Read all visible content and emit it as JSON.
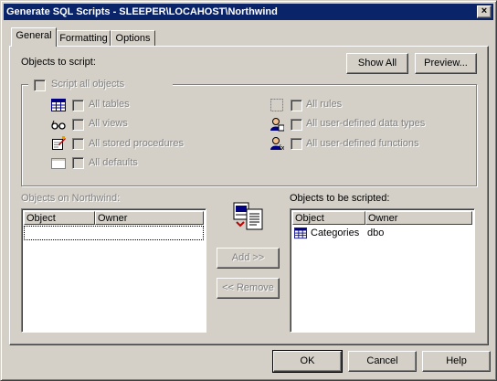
{
  "window": {
    "title": "Generate SQL Scripts - SLEEPER\\LOCAHOST\\Northwind",
    "close_glyph": "×"
  },
  "tabs": [
    {
      "label": "General",
      "active": true
    },
    {
      "label": "Formatting",
      "active": false
    },
    {
      "label": "Options",
      "active": false
    }
  ],
  "objects_to_script": {
    "label": "Objects to script:",
    "show_all": "Show All",
    "preview": "Preview...",
    "script_all": "Script all objects",
    "left_options": [
      {
        "label": "All tables",
        "icon": "table-icon"
      },
      {
        "label": "All views",
        "icon": "glasses-icon"
      },
      {
        "label": "All stored procedures",
        "icon": "stored-procedure-icon"
      },
      {
        "label": "All defaults",
        "icon": "default-icon"
      }
    ],
    "right_options": [
      {
        "label": "All rules",
        "icon": "rule-icon"
      },
      {
        "label": "All user-defined data types",
        "icon": "user-type-icon"
      },
      {
        "label": "All user-defined functions",
        "icon": "user-function-icon"
      }
    ]
  },
  "objects_on_db": {
    "label": "Objects on Northwind:",
    "columns": [
      "Object",
      "Owner"
    ],
    "rows": []
  },
  "objects_scripted": {
    "label": "Objects to be scripted:",
    "columns": [
      "Object",
      "Owner"
    ],
    "rows": [
      {
        "object": "Categories",
        "owner": "dbo"
      }
    ]
  },
  "middle": {
    "add": "Add >>",
    "remove": "<< Remove"
  },
  "footer": {
    "ok": "OK",
    "cancel": "Cancel",
    "help": "Help"
  }
}
